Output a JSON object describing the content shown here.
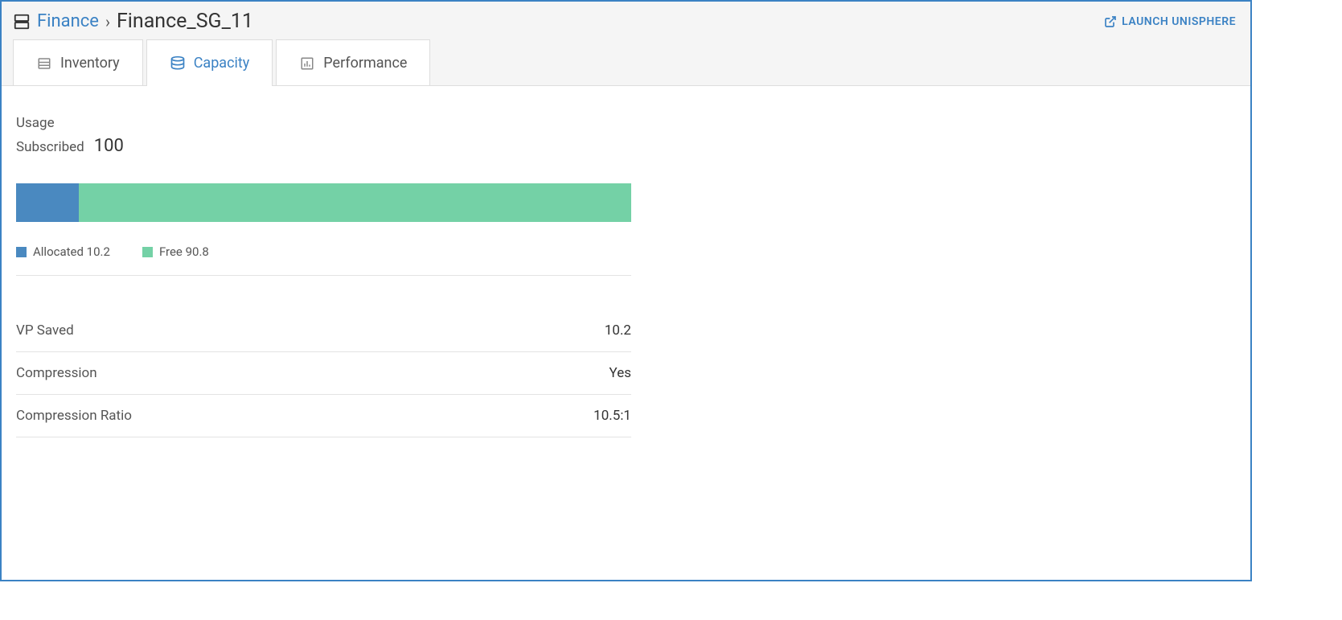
{
  "breadcrumb": {
    "parent": "Finance",
    "title": "Finance_SG_11"
  },
  "launch_label": "LAUNCH UNISPHERE",
  "tabs": {
    "inventory": "Inventory",
    "capacity": "Capacity",
    "performance": "Performance"
  },
  "usage_label": "Usage",
  "subscribed_label": "Subscribed",
  "subscribed_value": "100",
  "legend": {
    "allocated": "Allocated 10.2",
    "free": "Free 90.8"
  },
  "stats": {
    "vp_saved_label": "VP Saved",
    "vp_saved_value": "10.2",
    "compression_label": "Compression",
    "compression_value": "Yes",
    "ratio_label": "Compression Ratio",
    "ratio_value": "10.5:1"
  },
  "chart_data": {
    "type": "bar",
    "orientation": "stacked-horizontal",
    "title": "Usage",
    "total": 100,
    "series": [
      {
        "name": "Allocated",
        "values": [
          10.2
        ],
        "color": "#4a89c0"
      },
      {
        "name": "Free",
        "values": [
          90.8
        ],
        "color": "#74d1a6"
      }
    ]
  }
}
